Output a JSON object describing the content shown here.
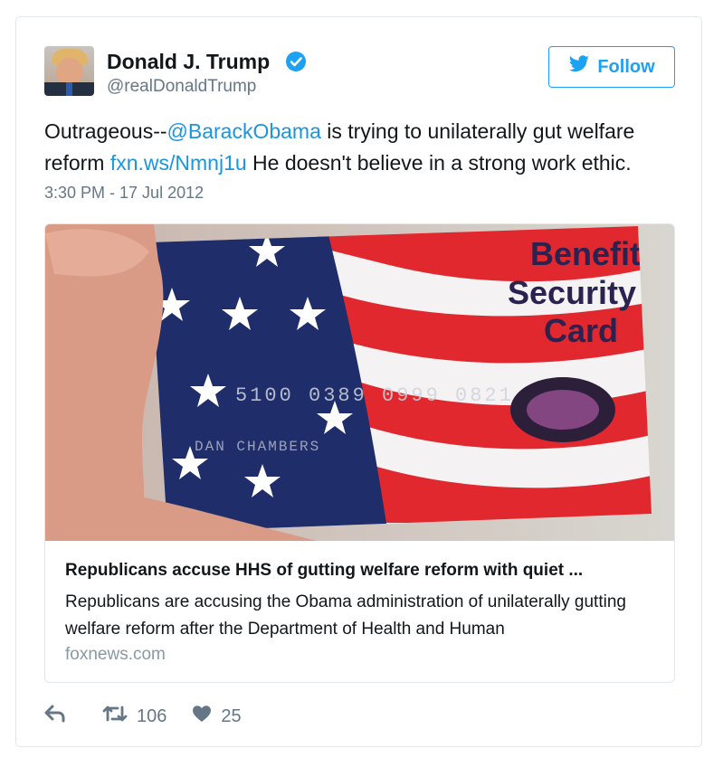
{
  "tweet": {
    "author_name": "Donald J. Trump",
    "handle": "@realDonaldTrump",
    "follow_label": "Follow",
    "text_prefix": "Outrageous--",
    "mention": "@BarackObama",
    "text_mid": " is trying to unilaterally gut welfare reform ",
    "link": "fxn.ws/Nmnj1u",
    "text_suffix": " He doesn't believe in a strong work ethic.",
    "timestamp": "3:30 PM - 17 Jul 2012"
  },
  "card": {
    "image_text_line1": "Benefit",
    "image_text_line2": "Security",
    "image_text_line3": "Card",
    "title": "Republicans accuse HHS of gutting welfare reform with quiet ...",
    "description": "Republicans are accusing the Obama administration of unilaterally gutting welfare reform after the Department of Health and Human",
    "domain": "foxnews.com"
  },
  "actions": {
    "reply_icon": "reply-icon",
    "retweet_icon": "retweet-icon",
    "retweet_count": "106",
    "like_icon": "heart-icon",
    "like_count": "25"
  },
  "colors": {
    "accent": "#1da1f2",
    "link": "#1b95e0",
    "muted": "#657786"
  }
}
